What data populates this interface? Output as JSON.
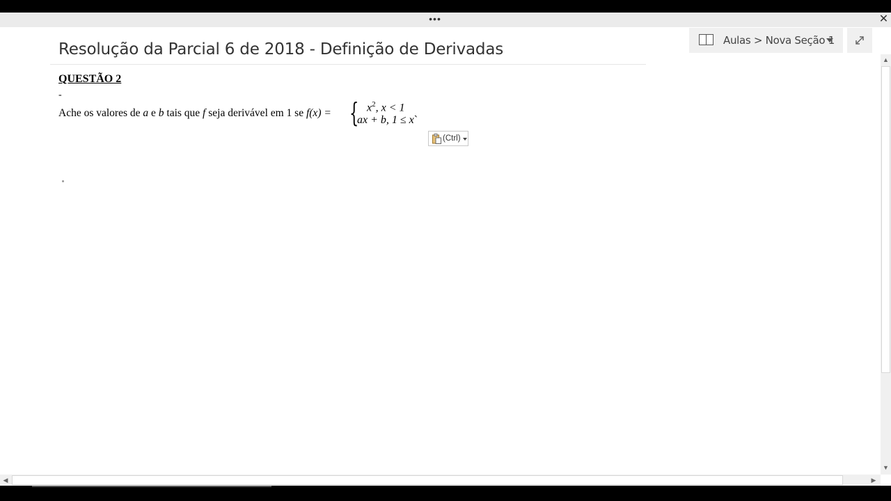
{
  "window": {
    "more_label": "•••",
    "close_label": "✕"
  },
  "page": {
    "title": "Resolução da Parcial 6 de 2018 - Definição de Derivadas"
  },
  "nav": {
    "breadcrumb": "Aulas > Nova Seção 1",
    "notebook_icon": "notebook-icon",
    "dropdown_icon": "chevron-down-icon",
    "expand_icon": "expand-icon"
  },
  "content": {
    "question_title": "QUESTÃO 2",
    "dash": "-",
    "text_1": "Ache os valores de ",
    "var_a": "a",
    "text_2": " e ",
    "var_b": "b",
    "text_3": " tais que ",
    "var_f": "f",
    "text_4": " seja derivável em 1 se ",
    "fx": "f(x) = ",
    "case_1_base": "x",
    "case_1_exp": "2",
    "case_1_rest": ", x < 1",
    "case_2": "ax + b, 1 ≤ x",
    "case_2_trailing": "`"
  },
  "paste_options": {
    "label": "(Ctrl)"
  },
  "scrollbars": {
    "up": "▲",
    "down": "▼",
    "left": "◀",
    "right": "▶"
  }
}
